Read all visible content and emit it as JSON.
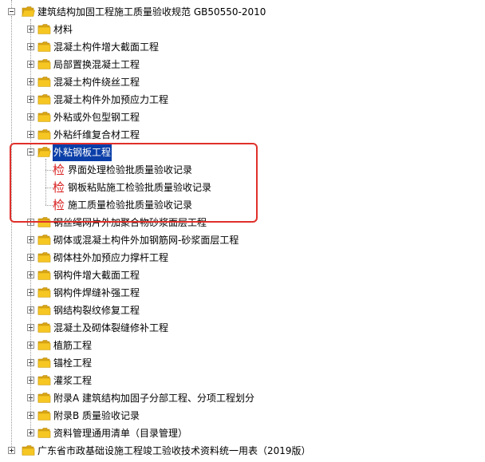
{
  "root_label": "建筑结构加固工程施工质量验收规范 GB50550-2010",
  "children": [
    {
      "label": "材料",
      "expanded": false
    },
    {
      "label": "混凝土构件增大截面工程",
      "expanded": false
    },
    {
      "label": "局部置换混凝土工程",
      "expanded": false
    },
    {
      "label": "混凝土构件绕丝工程",
      "expanded": false
    },
    {
      "label": "混凝土构件外加预应力工程",
      "expanded": false
    },
    {
      "label": "外粘或外包型钢工程",
      "expanded": false
    },
    {
      "label": "外粘纤维复合材工程",
      "expanded": false
    },
    {
      "label": "外粘钢板工程",
      "expanded": true,
      "selected": true,
      "records": [
        {
          "badge": "检",
          "label": "界面处理检验批质量验收记录"
        },
        {
          "badge": "检",
          "label": "钢板粘贴施工检验批质量验收记录"
        },
        {
          "badge": "检",
          "label": "施工质量检验批质量验收记录"
        }
      ]
    },
    {
      "label": "钢丝绳网片外加聚合物砂浆面层工程",
      "expanded": false
    },
    {
      "label": "砌体或混凝土构件外加钢筋网-砂浆面层工程",
      "expanded": false
    },
    {
      "label": "砌体柱外加预应力撑杆工程",
      "expanded": false
    },
    {
      "label": "钢构件增大截面工程",
      "expanded": false
    },
    {
      "label": "钢构件焊缝补强工程",
      "expanded": false
    },
    {
      "label": "钢结构裂纹修复工程",
      "expanded": false
    },
    {
      "label": "混凝土及砌体裂缝修补工程",
      "expanded": false
    },
    {
      "label": "植筋工程",
      "expanded": false
    },
    {
      "label": "锚栓工程",
      "expanded": false
    },
    {
      "label": "灌浆工程",
      "expanded": false
    },
    {
      "label": "附录A 建筑结构加固子分部工程、分项工程划分",
      "expanded": false
    },
    {
      "label": "附录B 质量验收记录",
      "expanded": false
    },
    {
      "label": "资料管理通用清单（目录管理）",
      "expanded": false
    }
  ],
  "sibling_label": "广东省市政基础设施工程竣工验收技术资料统一用表（2019版）",
  "colors": {
    "folder": "#f6c623",
    "folder_dark": "#d9a514",
    "selection": "#0a3ea8",
    "highlight_box": "#e0302a",
    "badge": "#d81e1e"
  },
  "icons": {
    "expander_collapsed": "plus-box-icon",
    "expander_expanded": "minus-box-icon",
    "folder_closed": "folder-icon",
    "folder_open": "folder-open-icon",
    "record": "inspection-record-icon"
  }
}
